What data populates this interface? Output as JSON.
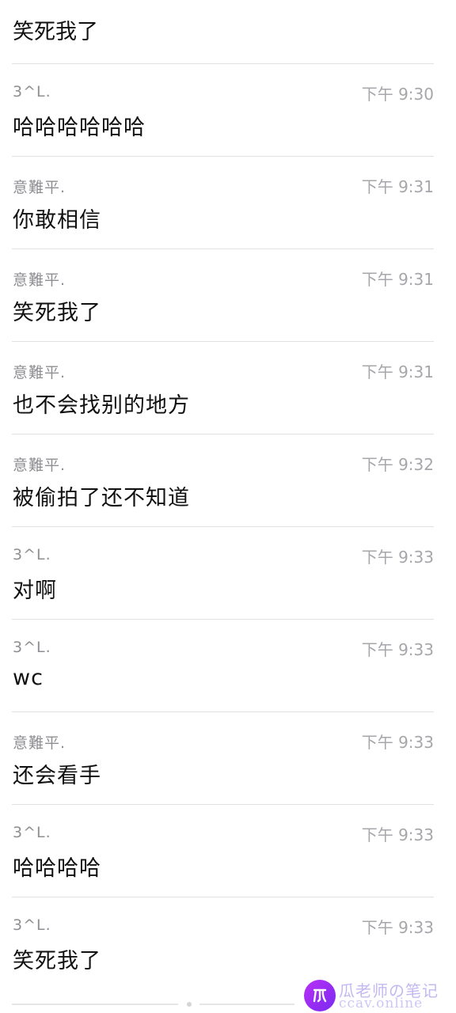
{
  "top_message": "笑死我了",
  "messages": [
    {
      "sender": "3^L.",
      "time": "下午 9:30",
      "text": "哈哈哈哈哈哈"
    },
    {
      "sender": "意難平.",
      "time": "下午 9:31",
      "text": "你敢相信"
    },
    {
      "sender": "意難平.",
      "time": "下午 9:31",
      "text": "笑死我了"
    },
    {
      "sender": "意難平.",
      "time": "下午 9:31",
      "text": "也不会找别的地方"
    },
    {
      "sender": "意難平.",
      "time": "下午 9:32",
      "text": "被偷拍了还不知道"
    },
    {
      "sender": "3^L.",
      "time": "下午 9:33",
      "text": "对啊"
    },
    {
      "sender": "3^L.",
      "time": "下午 9:33",
      "text": "wc"
    },
    {
      "sender": "意難平.",
      "time": "下午 9:33",
      "text": "还会看手"
    },
    {
      "sender": "3^L.",
      "time": "下午 9:33",
      "text": "哈哈哈哈"
    },
    {
      "sender": "3^L.",
      "time": "下午 9:33",
      "text": "笑死我了"
    }
  ],
  "watermark": {
    "title": "瓜老师の笔记",
    "subtitle": "ccav.online",
    "logo_glyph": "瓜",
    "logo_color": "#a62ef3"
  }
}
